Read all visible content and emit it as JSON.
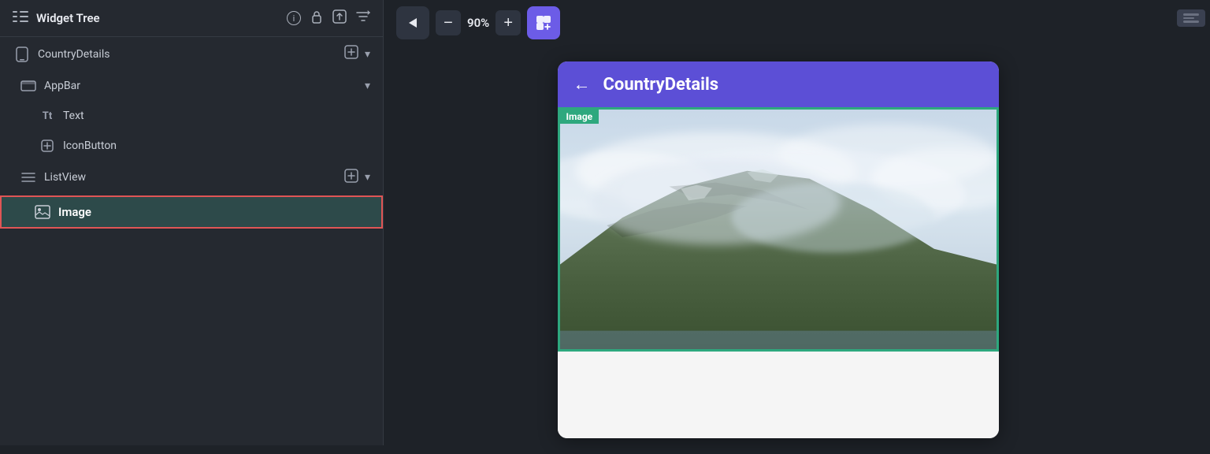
{
  "leftPanel": {
    "header": {
      "title": "Widget Tree",
      "info_icon": "ℹ",
      "lock_icon": "🔒",
      "upload_icon": "⊙",
      "sort_icon": "≡"
    },
    "treeItems": [
      {
        "id": "country-details",
        "label": "CountryDetails",
        "icon": "phone",
        "level": 0,
        "hasActions": true,
        "hasDropdown": true
      },
      {
        "id": "appbar",
        "label": "AppBar",
        "icon": "appbar",
        "level": 1,
        "hasDropdown": true
      },
      {
        "id": "text",
        "label": "Text",
        "icon": "Tt",
        "level": 2,
        "hasActions": false
      },
      {
        "id": "iconbutton",
        "label": "IconButton",
        "icon": "+",
        "level": 2,
        "hasActions": false
      },
      {
        "id": "listview",
        "label": "ListView",
        "icon": "≡",
        "level": 1,
        "hasActions": true,
        "hasDropdown": true
      },
      {
        "id": "image",
        "label": "Image",
        "icon": "img",
        "level": 2,
        "selected": true
      }
    ]
  },
  "toolbar": {
    "zoomIn_label": "+",
    "zoomOut_label": "−",
    "zoom_value": "90%",
    "add_icon": "⊕"
  },
  "canvas": {
    "appBar": {
      "title": "CountryDetails",
      "back_icon": "←"
    },
    "imageBadge": "Image",
    "scrollIndicator": true
  }
}
